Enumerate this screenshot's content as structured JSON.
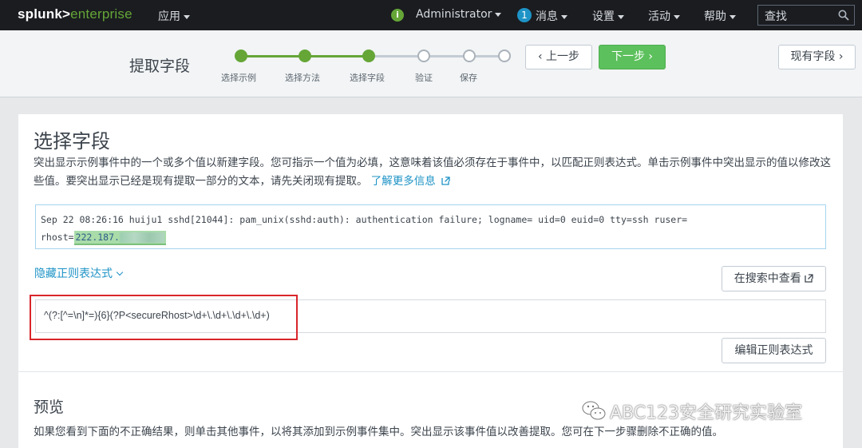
{
  "topnav": {
    "logo_a": "splunk>",
    "logo_b": "enterprise",
    "apps": "应用",
    "user": "Administrator",
    "messages_count": "1",
    "messages": "消息",
    "settings": "设置",
    "activity": "活动",
    "help": "帮助",
    "search_placeholder": "查找"
  },
  "wizard": {
    "title": "提取字段",
    "steps": [
      {
        "label": "选择示例",
        "status": "done"
      },
      {
        "label": "选择方法",
        "status": "done"
      },
      {
        "label": "选择字段",
        "status": "done"
      },
      {
        "label": "验证",
        "status": "todo"
      },
      {
        "label": "保存",
        "status": "todo"
      }
    ],
    "prev_button": "上一步",
    "next_button": "下一步",
    "existing_fields_button": "现有字段"
  },
  "main": {
    "title": "选择字段",
    "description": "突出显示示例事件中的一个或多个值以新建字段。您可指示一个值为必填，这意味着该值必须存在于事件中，以匹配正则表达式。单击示例事件中突出显示的值以修改这些值。要突出显示已经是现有提取一部分的文本，请先关闭现有提取。",
    "learn_more": "了解更多信息",
    "sample_event_line1": "Sep 22 08:26:16 huiju1 sshd[21044]: pam_unix(sshd:auth): authentication failure; logname= uid=0 euid=0 tty=ssh ruser=",
    "sample_event_prefix": "rhost=",
    "sample_event_highlight": "222.187.",
    "hide_regex": "隐藏正则表达式",
    "view_in_search": "在搜索中查看",
    "regex": "^(?:[^=\\n]*=){6}(?P<secureRhost>\\d+\\.\\d+\\.\\d+\\.\\d+)",
    "edit_regex": "编辑正则表达式"
  },
  "preview": {
    "title": "预览",
    "description": "如果您看到下面的不正确结果，则单击其他事件，以将其添加到示例事件集中。突出显示该事件值以改善提取。您可在下一步骤删除不正确的值。"
  },
  "watermark": "ABC123安全研究实验室",
  "colors": {
    "accent_green": "#65a637",
    "primary_button": "#5cc05c",
    "link_blue": "#1e93c6",
    "highlight_red": "#d9262c"
  }
}
